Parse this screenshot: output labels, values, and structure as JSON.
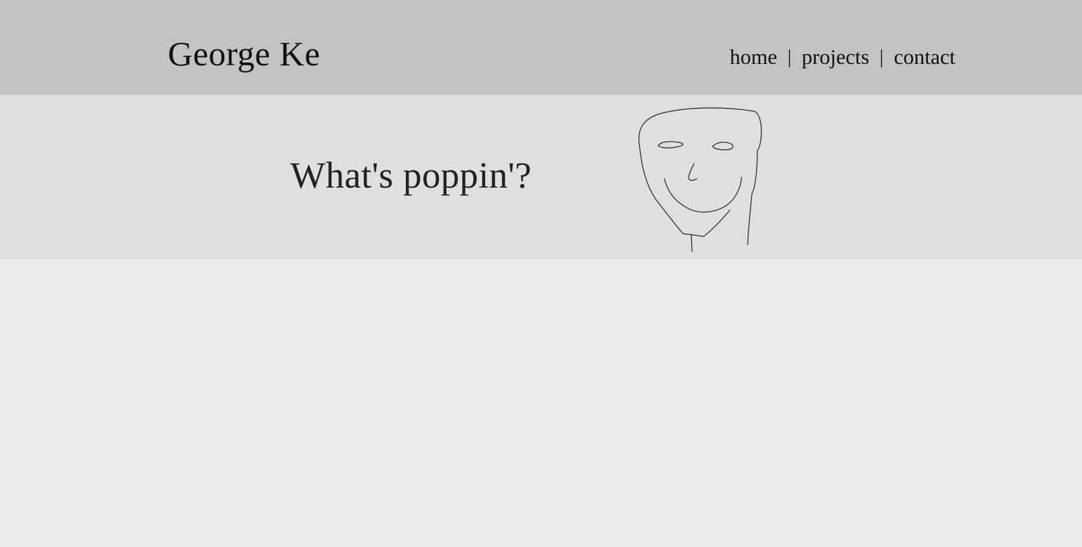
{
  "header": {
    "site_title": "George Ke",
    "nav": {
      "home": "home",
      "separator_1": "|",
      "projects": "projects",
      "separator_2": "|",
      "contact": "contact"
    }
  },
  "hero": {
    "greeting": "What's poppin'?",
    "drawing_icon": "hand-drawn-smiley-face-icon"
  },
  "colors": {
    "header_background": "#c3c3c3",
    "hero_background": "#dfdfdf",
    "page_background": "#e9e9e9",
    "text": "#111111"
  }
}
